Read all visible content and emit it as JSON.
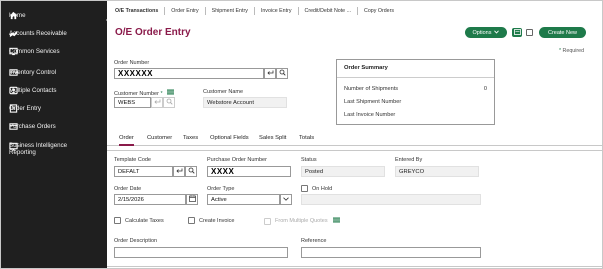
{
  "sidebar": {
    "items": [
      {
        "label": "Home",
        "icon": "home-icon"
      },
      {
        "label": "Accounts Receivable",
        "icon": "receivables-icon"
      },
      {
        "label": "Common Services",
        "icon": "services-icon"
      },
      {
        "label": "Inventory Control",
        "icon": "inventory-icon"
      },
      {
        "label": "Multiple Contacts",
        "icon": "contacts-icon"
      },
      {
        "label": "Order Entry",
        "icon": "order-entry-icon"
      },
      {
        "label": "Purchase Orders",
        "icon": "purchase-orders-icon"
      },
      {
        "label": "Business Intelligence Reporting",
        "icon": "reporting-icon"
      }
    ]
  },
  "breadcrumbs": [
    "O/E Transactions",
    "Order Entry",
    "Shipment Entry",
    "Invoice Entry",
    "Credit/Debit Note ...",
    "Copy Orders"
  ],
  "page": {
    "title": "O/E Order Entry"
  },
  "toolbar": {
    "options_label": "Options",
    "create_label": "Create New",
    "required_note": "Required"
  },
  "header_form": {
    "order_number_label": "Order Number",
    "order_number_value": "XXXXXX",
    "customer_number_label": "Customer Number",
    "customer_number_value": "WEBS",
    "customer_name_label": "Customer Name",
    "customer_name_value": "Webstore Account"
  },
  "order_summary": {
    "title": "Order Summary",
    "rows": [
      {
        "label": "Number of Shipments",
        "value": "0"
      },
      {
        "label": "Last Shipment Number",
        "value": ""
      },
      {
        "label": "Last Invoice Number",
        "value": ""
      }
    ]
  },
  "tabs": [
    "Order",
    "Customer",
    "Taxes",
    "Optional Fields",
    "Sales Split",
    "Totals"
  ],
  "active_tab": "Order",
  "order_tab": {
    "template_code_label": "Template Code",
    "template_code_value": "DEFALT",
    "po_number_label": "Purchase Order Number",
    "po_number_value": "XXXX",
    "status_label": "Status",
    "status_value": "Posted",
    "entered_by_label": "Entered By",
    "entered_by_value": "GREYCO",
    "order_date_label": "Order Date",
    "order_date_value": "2/15/2026",
    "order_type_label": "Order Type",
    "order_type_value": "Active",
    "on_hold_label": "On Hold",
    "calculate_taxes_label": "Calculate Taxes",
    "create_invoice_label": "Create Invoice",
    "from_multiple_quotes_label": "From Multiple Quotes",
    "order_description_label": "Order Description",
    "reference_label": "Reference"
  },
  "colors": {
    "accent": "#8a1a4a",
    "brand_green": "#1e7a4a",
    "sidebar_bg": "#1f1f1f"
  }
}
